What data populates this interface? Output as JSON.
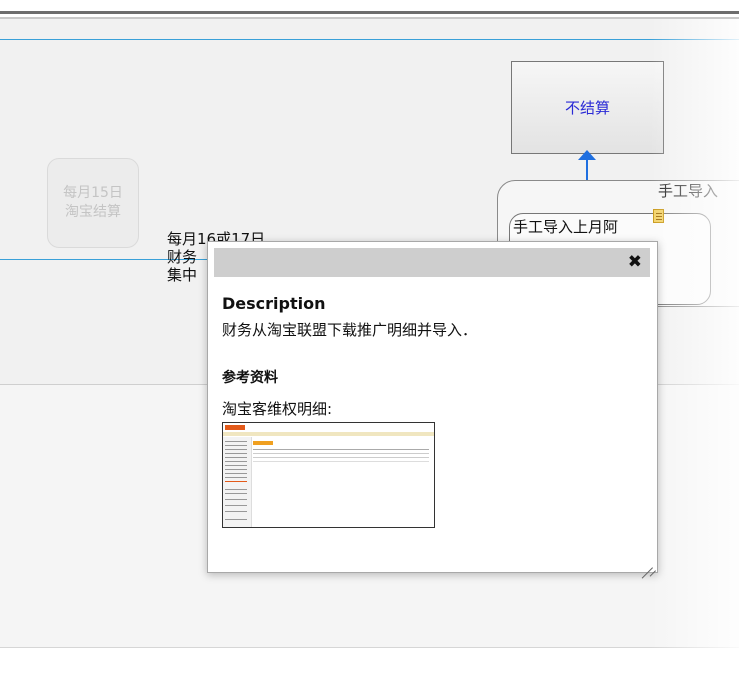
{
  "diagram": {
    "faded_node": {
      "line1": "每月15日",
      "line2": "淘宝结算"
    },
    "left_text": {
      "line1": "每月16或17日",
      "line2": "财务",
      "line3": "集中"
    },
    "node_no_settle": "不结算",
    "group_label": "手工导入",
    "task_label": "手工导入上月阿"
  },
  "popup": {
    "description_heading": "Description",
    "description_text": "财务从淘宝联盟下载推广明细并导入．",
    "reference_heading": "参考资料",
    "reference_item": "淘宝客维权明细:",
    "close_icon": "✖"
  },
  "colors": {
    "flow_line": "#3aa0d8",
    "arrow": "#1f6fe0",
    "link_text": "#2b2bd6"
  }
}
